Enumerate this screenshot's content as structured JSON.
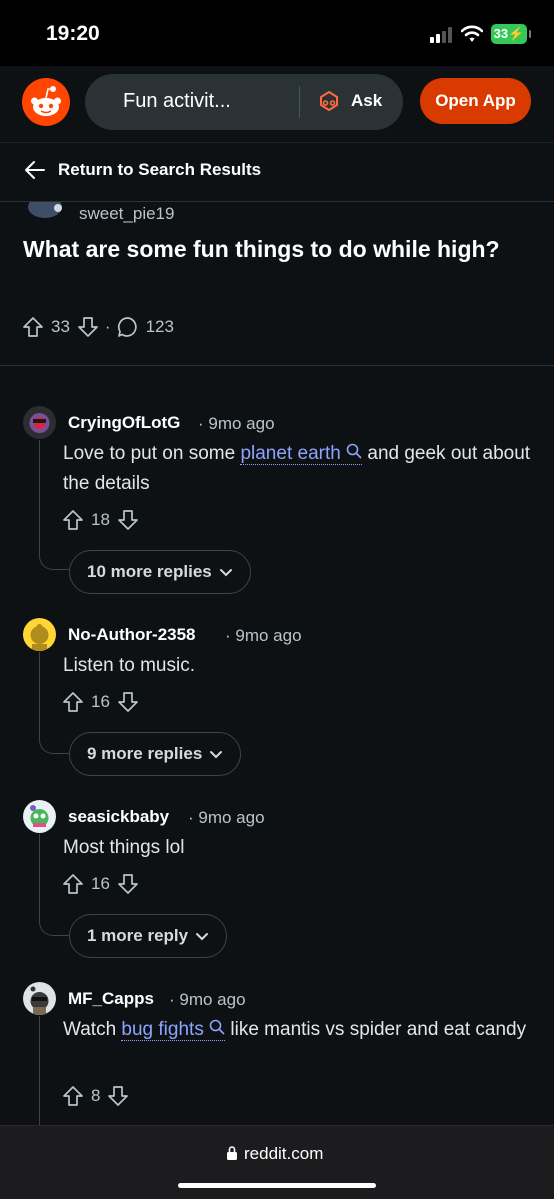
{
  "status_bar": {
    "time": "19:20",
    "battery": "33"
  },
  "header": {
    "search_text": "Fun activit...",
    "ask_label": "Ask",
    "open_app_label": "Open App"
  },
  "back": {
    "label": "Return to Search Results"
  },
  "post": {
    "author": "sweet_pie19",
    "title": "What are some fun things to do while high?",
    "votes": "33",
    "comments": "123"
  },
  "comments": [
    {
      "author": "CryingOfLotG",
      "time": "9mo ago",
      "body_pre": "Love to put on some ",
      "link": "planet earth",
      "body_post": " and geek out about the details",
      "votes": "18",
      "more": "10 more replies"
    },
    {
      "author": "No-Author-2358",
      "time": "9mo ago",
      "body": "Listen to music.",
      "votes": "16",
      "more": "9 more replies"
    },
    {
      "author": "seasickbaby",
      "time": "9mo ago",
      "body": "Most things lol",
      "votes": "16",
      "more": "1 more reply"
    },
    {
      "author": "MF_Capps",
      "time": "9mo ago",
      "body_pre": "Watch ",
      "link": "bug fights",
      "body_post": " like mantis vs spider and eat candy",
      "votes": "8"
    }
  ],
  "footer": {
    "domain": "reddit.com"
  },
  "colors": {
    "brand": "#ff4500",
    "open_app": "#d93a00",
    "link": "#8ba5ff",
    "background": "#0e1113"
  },
  "icons": [
    "reddit-logo-icon",
    "ask-icon",
    "back-arrow-icon",
    "upvote-icon",
    "downvote-icon",
    "comment-icon",
    "search-icon",
    "chevron-down-icon",
    "lock-icon"
  ]
}
